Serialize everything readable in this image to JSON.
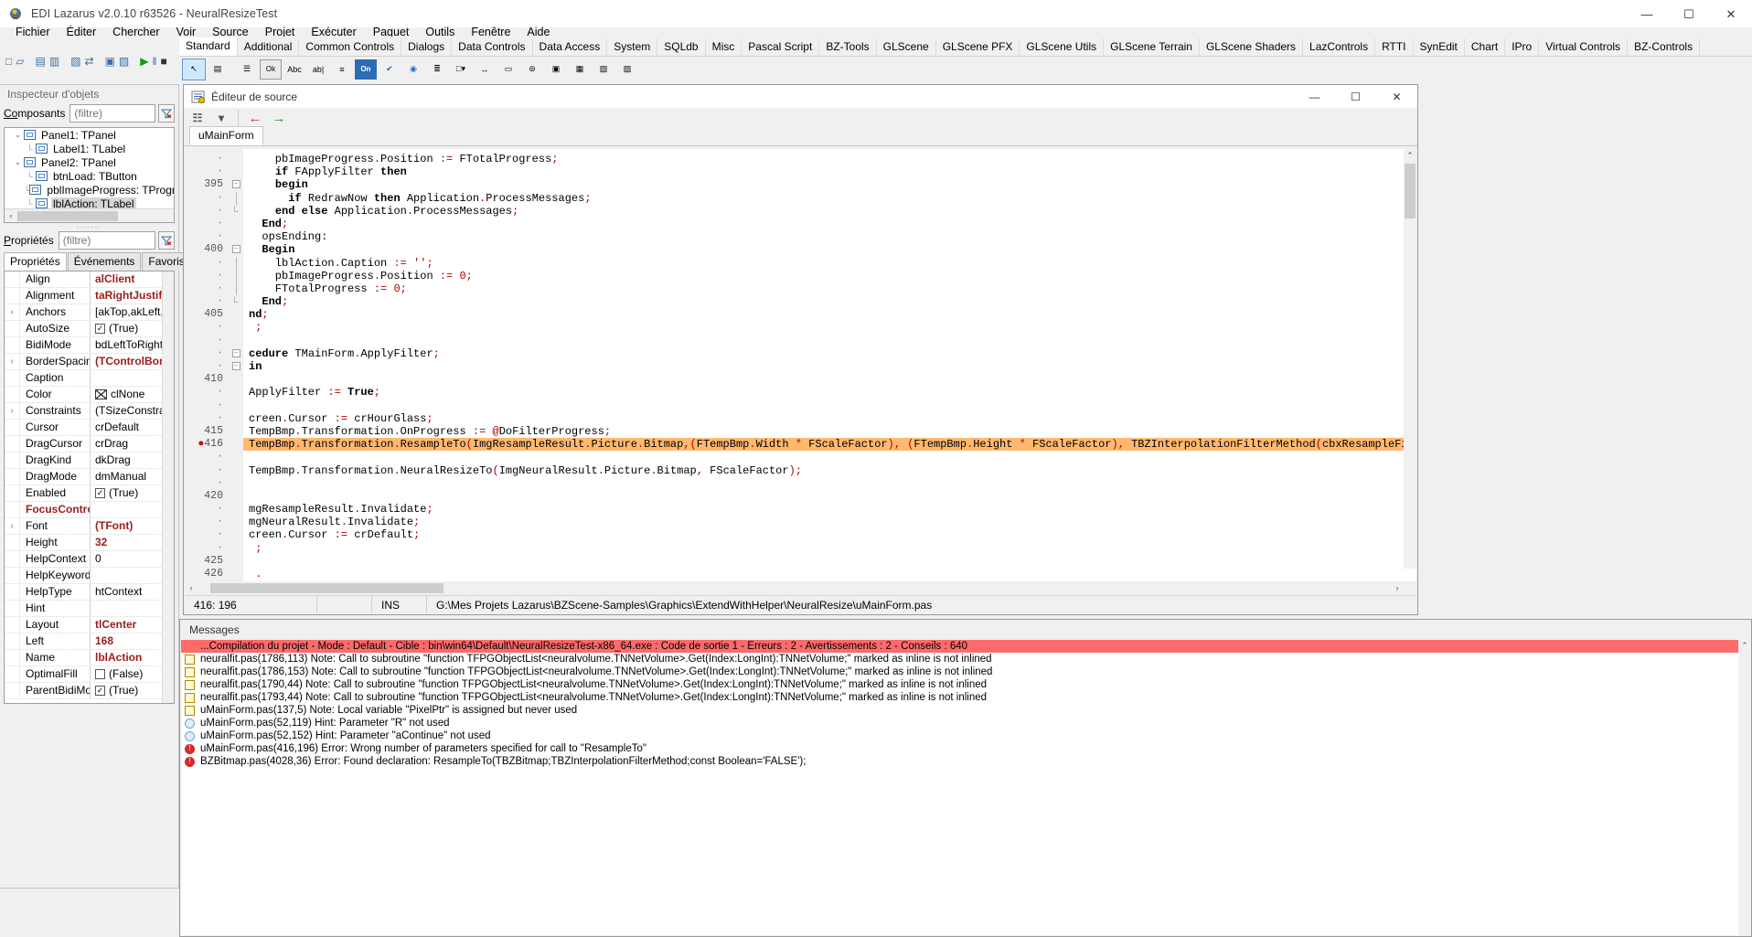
{
  "window": {
    "title": "EDI Lazarus v2.0.10 r63526 - NeuralResizeTest",
    "icon": "lazarus-icon",
    "controls": {
      "minimize": "—",
      "maximize": "☐",
      "close": "✕"
    }
  },
  "menu": {
    "items": [
      "Fichier",
      "Éditer",
      "Chercher",
      "Voir",
      "Source",
      "Projet",
      "Exécuter",
      "Paquet",
      "Outils",
      "Fenêtre",
      "Aide"
    ]
  },
  "palette": {
    "tabs": [
      "Standard",
      "Additional",
      "Common Controls",
      "Dialogs",
      "Data Controls",
      "Data Access",
      "System",
      "SQLdb",
      "Misc",
      "Pascal Script",
      "BZ-Tools",
      "GLScene",
      "GLScene PFX",
      "GLScene Utils",
      "GLScene Terrain",
      "GLScene Shaders",
      "LazControls",
      "RTTI",
      "SynEdit",
      "Chart",
      "IPro",
      "Virtual Controls",
      "BZ-Controls"
    ],
    "active_tab": "Standard",
    "icons": [
      {
        "name": "select-pointer-icon",
        "glyph": "↖"
      },
      {
        "name": "tframe-icon",
        "glyph": "▤"
      },
      {
        "name": "tmainmenu-icon",
        "glyph": "☰"
      },
      {
        "name": "tbutton-icon",
        "glyph": "Ok"
      },
      {
        "name": "tlabel-icon",
        "glyph": "Abc"
      },
      {
        "name": "tedit-icon",
        "glyph": "ab|"
      },
      {
        "name": "tmemo-icon",
        "glyph": "≡"
      },
      {
        "name": "ttogglebox-icon",
        "glyph": "On"
      },
      {
        "name": "tcheckbox-icon",
        "glyph": "✔"
      },
      {
        "name": "tradiobutton-icon",
        "glyph": "◉"
      },
      {
        "name": "tlistbox-icon",
        "glyph": "≣"
      },
      {
        "name": "tcombobox-icon",
        "glyph": "□▾"
      },
      {
        "name": "tscrollbar-icon",
        "glyph": "↔"
      },
      {
        "name": "tgroupbox-icon",
        "glyph": "▭"
      },
      {
        "name": "tradiogroup-icon",
        "glyph": "⊜"
      },
      {
        "name": "tpanel-icon",
        "glyph": "▣"
      },
      {
        "name": "tactionlist-icon",
        "glyph": "▦"
      },
      {
        "name": "tpagecontrol-icon",
        "glyph": "▧"
      },
      {
        "name": "tscrollbox-icon",
        "glyph": "▨"
      }
    ]
  },
  "toolbar": {
    "buttons": [
      {
        "name": "new-unit-button",
        "glyph": "□"
      },
      {
        "name": "open-file-button",
        "glyph": "▱"
      },
      {
        "name": "save-file-button",
        "glyph": "▤"
      },
      {
        "name": "save-all-button",
        "glyph": "▥"
      },
      {
        "name": "new-form-button",
        "glyph": "▧"
      },
      {
        "name": "toggle-form-unit-button",
        "glyph": "⇄"
      },
      {
        "name": "view-units-button",
        "glyph": "▣"
      },
      {
        "name": "view-forms-button",
        "glyph": "▨"
      },
      {
        "name": "run-button",
        "glyph": "▶"
      },
      {
        "name": "pause-button",
        "glyph": "‖"
      },
      {
        "name": "stop-button",
        "glyph": "■"
      },
      {
        "name": "step-into-button",
        "glyph": "↓"
      },
      {
        "name": "step-over-button",
        "glyph": "↷"
      }
    ]
  },
  "object_inspector": {
    "title": "Inspecteur d'objets",
    "components_label": "Composants",
    "components_filter_placeholder": "(filtre)",
    "components_filter_value": "",
    "properties_label": "Propriétés",
    "properties_filter_placeholder": "(filtre)",
    "properties_filter_value": "",
    "tree": [
      {
        "label": "Panel1: TPanel",
        "depth": 1,
        "expander": "⌄",
        "selected": false
      },
      {
        "label": "Label1: TLabel",
        "depth": 2,
        "expander": "",
        "selected": false
      },
      {
        "label": "Panel2: TPanel",
        "depth": 1,
        "expander": "⌄",
        "selected": false
      },
      {
        "label": "btnLoad: TButton",
        "depth": 2,
        "expander": "",
        "selected": false
      },
      {
        "label": "pblImageProgress: TProgre",
        "depth": 2,
        "expander": "",
        "selected": false
      },
      {
        "label": "lblAction: TLabel",
        "depth": 2,
        "expander": "",
        "selected": true
      }
    ],
    "tabs": [
      {
        "label": "Propriétés",
        "active": true
      },
      {
        "label": "Événements",
        "active": false
      },
      {
        "label": "Favoris",
        "active": false
      }
    ],
    "tab_nav": [
      "‹",
      "›"
    ],
    "properties": [
      {
        "name": "Align",
        "value": "alClient",
        "expand": false,
        "name_red": false,
        "value_red": true,
        "kind": "text"
      },
      {
        "name": "Alignment",
        "value": "taRightJustify",
        "expand": false,
        "name_red": false,
        "value_red": true,
        "kind": "text"
      },
      {
        "name": "Anchors",
        "value": "[akTop,akLeft,akR",
        "expand": true,
        "name_red": false,
        "value_red": false,
        "kind": "text"
      },
      {
        "name": "AutoSize",
        "value": "(True)",
        "expand": false,
        "name_red": false,
        "value_red": false,
        "kind": "check",
        "checked": true
      },
      {
        "name": "BidiMode",
        "value": "bdLeftToRight",
        "expand": false,
        "name_red": false,
        "value_red": false,
        "kind": "text"
      },
      {
        "name": "BorderSpacing",
        "value": "(TControlBorder",
        "expand": true,
        "name_red": false,
        "value_red": true,
        "kind": "text"
      },
      {
        "name": "Caption",
        "value": "",
        "expand": false,
        "name_red": false,
        "value_red": false,
        "kind": "text"
      },
      {
        "name": "Color",
        "value": "clNone",
        "expand": false,
        "name_red": false,
        "value_red": false,
        "kind": "color"
      },
      {
        "name": "Constraints",
        "value": "(TSizeConstraints",
        "expand": true,
        "name_red": false,
        "value_red": false,
        "kind": "text"
      },
      {
        "name": "Cursor",
        "value": "crDefault",
        "expand": false,
        "name_red": false,
        "value_red": false,
        "kind": "text"
      },
      {
        "name": "DragCursor",
        "value": "crDrag",
        "expand": false,
        "name_red": false,
        "value_red": false,
        "kind": "text"
      },
      {
        "name": "DragKind",
        "value": "dkDrag",
        "expand": false,
        "name_red": false,
        "value_red": false,
        "kind": "text"
      },
      {
        "name": "DragMode",
        "value": "dmManual",
        "expand": false,
        "name_red": false,
        "value_red": false,
        "kind": "text"
      },
      {
        "name": "Enabled",
        "value": "(True)",
        "expand": false,
        "name_red": false,
        "value_red": false,
        "kind": "check",
        "checked": true
      },
      {
        "name": "FocusControl",
        "value": "",
        "expand": false,
        "name_red": true,
        "value_red": false,
        "kind": "text"
      },
      {
        "name": "Font",
        "value": "(TFont)",
        "expand": true,
        "name_red": false,
        "value_red": true,
        "kind": "text"
      },
      {
        "name": "Height",
        "value": "32",
        "expand": false,
        "name_red": false,
        "value_red": true,
        "kind": "text"
      },
      {
        "name": "HelpContext",
        "value": "0",
        "expand": false,
        "name_red": false,
        "value_red": false,
        "kind": "text"
      },
      {
        "name": "HelpKeyword",
        "value": "",
        "expand": false,
        "name_red": false,
        "value_red": false,
        "kind": "text"
      },
      {
        "name": "HelpType",
        "value": "htContext",
        "expand": false,
        "name_red": false,
        "value_red": false,
        "kind": "text"
      },
      {
        "name": "Hint",
        "value": "",
        "expand": false,
        "name_red": false,
        "value_red": false,
        "kind": "text"
      },
      {
        "name": "Layout",
        "value": "tlCenter",
        "expand": false,
        "name_red": false,
        "value_red": true,
        "kind": "text"
      },
      {
        "name": "Left",
        "value": "168",
        "expand": false,
        "name_red": false,
        "value_red": true,
        "kind": "text"
      },
      {
        "name": "Name",
        "value": "lblAction",
        "expand": false,
        "name_red": false,
        "value_red": true,
        "kind": "text"
      },
      {
        "name": "OptimalFill",
        "value": "(False)",
        "expand": false,
        "name_red": false,
        "value_red": false,
        "kind": "check",
        "checked": false
      },
      {
        "name": "ParentBidiMode",
        "value": "(True)",
        "expand": false,
        "name_red": false,
        "value_red": false,
        "kind": "check",
        "checked": true
      }
    ]
  },
  "source_editor": {
    "title": "Éditeur de source",
    "icon": "source-editor-icon",
    "controls": {
      "minimize": "—",
      "maximize": "☐",
      "close": "✕"
    },
    "toolbar": [
      {
        "name": "bookmark-list-button",
        "glyph": "☷"
      },
      {
        "name": "dropdown-button",
        "glyph": "▾"
      },
      {
        "name": "jump-back-button",
        "glyph": "←"
      },
      {
        "name": "jump-forward-button",
        "glyph": "→"
      }
    ],
    "tabs": [
      {
        "label": "uMainForm",
        "active": true
      }
    ],
    "status": {
      "caret": "416: 196",
      "modified": "",
      "insert_mode": "INS",
      "file_path": "G:\\Mes Projets Lazarus\\BZScene-Samples\\Graphics\\ExtendWithHelper\\NeuralResize\\uMainForm.pas"
    },
    "lines": [
      {
        "num": "",
        "text": "    pbImageProgress.Position := FTotalProgress;",
        "error": false,
        "fold": ""
      },
      {
        "num": "",
        "text": "    if FApplyFilter then",
        "error": false,
        "fold": ""
      },
      {
        "num": "395",
        "text": "    begin",
        "error": false,
        "fold": "box"
      },
      {
        "num": "",
        "text": "      if RedrawNow then Application.ProcessMessages;",
        "error": false,
        "fold": "bar"
      },
      {
        "num": "",
        "text": "    end else Application.ProcessMessages;",
        "error": false,
        "fold": "end"
      },
      {
        "num": "",
        "text": "  End;",
        "error": false,
        "fold": ""
      },
      {
        "num": "",
        "text": "  opsEnding:",
        "error": false,
        "fold": ""
      },
      {
        "num": "400",
        "text": "  Begin",
        "error": false,
        "fold": "box"
      },
      {
        "num": "",
        "text": "    lblAction.Caption := '';",
        "error": false,
        "fold": "bar"
      },
      {
        "num": "",
        "text": "    pbImageProgress.Position := 0;",
        "error": false,
        "fold": "bar"
      },
      {
        "num": "",
        "text": "    FTotalProgress := 0;",
        "error": false,
        "fold": "bar"
      },
      {
        "num": "",
        "text": "  End;",
        "error": false,
        "fold": "end"
      },
      {
        "num": "405",
        "text": "nd;",
        "error": false,
        "fold": ""
      },
      {
        "num": "",
        "text": " ;",
        "error": false,
        "fold": ""
      },
      {
        "num": "",
        "text": "",
        "error": false,
        "fold": ""
      },
      {
        "num": "",
        "text": "cedure TMainForm.ApplyFilter;",
        "error": false,
        "fold": "box"
      },
      {
        "num": "",
        "text": "in",
        "error": false,
        "fold": "box"
      },
      {
        "num": "410",
        "text": "",
        "error": false,
        "fold": ""
      },
      {
        "num": "",
        "text": "ApplyFilter := True;",
        "error": false,
        "fold": ""
      },
      {
        "num": "",
        "text": "",
        "error": false,
        "fold": ""
      },
      {
        "num": "",
        "text": "creen.Cursor := crHourGlass;",
        "error": false,
        "fold": ""
      },
      {
        "num": "415",
        "text": "TempBmp.Transformation.OnProgress := @DoFilterProgress;",
        "error": false,
        "fold": ""
      },
      {
        "num": "416",
        "text": "TempBmp.Transformation.ResampleTo(ImgResampleResult.Picture.Bitmap,(FTempBmp.Width * FScaleFactor), (FTempBmp.Height * FScaleFactor), TBZInterpolationFilterMethod(cbxResampleFilter.ItemIndex));",
        "error": true,
        "fold": ""
      },
      {
        "num": "",
        "text": "",
        "error": false,
        "fold": ""
      },
      {
        "num": "",
        "text": "TempBmp.Transformation.NeuralResizeTo(ImgNeuralResult.Picture.Bitmap, FScaleFactor);",
        "error": false,
        "fold": ""
      },
      {
        "num": "",
        "text": "",
        "error": false,
        "fold": ""
      },
      {
        "num": "420",
        "text": "",
        "error": false,
        "fold": ""
      },
      {
        "num": "",
        "text": "mgResampleResult.Invalidate;",
        "error": false,
        "fold": ""
      },
      {
        "num": "",
        "text": "mgNeuralResult.Invalidate;",
        "error": false,
        "fold": ""
      },
      {
        "num": "",
        "text": "creen.Cursor := crDefault;",
        "error": false,
        "fold": ""
      },
      {
        "num": "",
        "text": " ;",
        "error": false,
        "fold": ""
      },
      {
        "num": "425",
        "text": "",
        "error": false,
        "fold": ""
      },
      {
        "num": "426",
        "text": " .",
        "error": false,
        "fold": ""
      }
    ]
  },
  "messages": {
    "title": "Messages",
    "rows": [
      {
        "icon": "none",
        "text": "...Compilation du projet - Mode : Default - Cible : bin\\win64\\Default\\NeuralResizeTest-x86_64.exe : Code de sortie 1 - Erreurs : 2 - Avertissements : 2 - Conseils : 640",
        "kind": "header"
      },
      {
        "icon": "note",
        "text": "neuralfit.pas(1786,113) Note: Call to subroutine \"function TFPGObjectList<neuralvolume.TNNetVolume>.Get(Index:LongInt):TNNetVolume;\" marked as inline is not inlined",
        "kind": "note"
      },
      {
        "icon": "note",
        "text": "neuralfit.pas(1786,153) Note: Call to subroutine \"function TFPGObjectList<neuralvolume.TNNetVolume>.Get(Index:LongInt):TNNetVolume;\" marked as inline is not inlined",
        "kind": "note"
      },
      {
        "icon": "note",
        "text": "neuralfit.pas(1790,44) Note: Call to subroutine \"function TFPGObjectList<neuralvolume.TNNetVolume>.Get(Index:LongInt):TNNetVolume;\" marked as inline is not inlined",
        "kind": "note"
      },
      {
        "icon": "note",
        "text": "neuralfit.pas(1793,44) Note: Call to subroutine \"function TFPGObjectList<neuralvolume.TNNetVolume>.Get(Index:LongInt):TNNetVolume;\" marked as inline is not inlined",
        "kind": "note"
      },
      {
        "icon": "note",
        "text": "uMainForm.pas(137,5) Note: Local variable \"PixelPtr\" is assigned but never used",
        "kind": "note"
      },
      {
        "icon": "hint",
        "text": "uMainForm.pas(52,119) Hint: Parameter \"R\" not used",
        "kind": "hint"
      },
      {
        "icon": "hint",
        "text": "uMainForm.pas(52,152) Hint: Parameter \"aContinue\" not used",
        "kind": "hint"
      },
      {
        "icon": "error",
        "text": "uMainForm.pas(416,196) Error: Wrong number of parameters specified for call to \"ResampleTo\"",
        "kind": "error"
      },
      {
        "icon": "error",
        "text": "BZBitmap.pas(4028,36) Error: Found declaration: ResampleTo(TBZBitmap;TBZInterpolationFilterMethod;const Boolean='FALSE');",
        "kind": "error"
      }
    ]
  },
  "colors": {
    "error_highlight": "#ffb96e",
    "header_error": "#ff6a6a",
    "property_red": "#9b1c1c",
    "keyword": "#000000",
    "symbol": "#b00000"
  }
}
